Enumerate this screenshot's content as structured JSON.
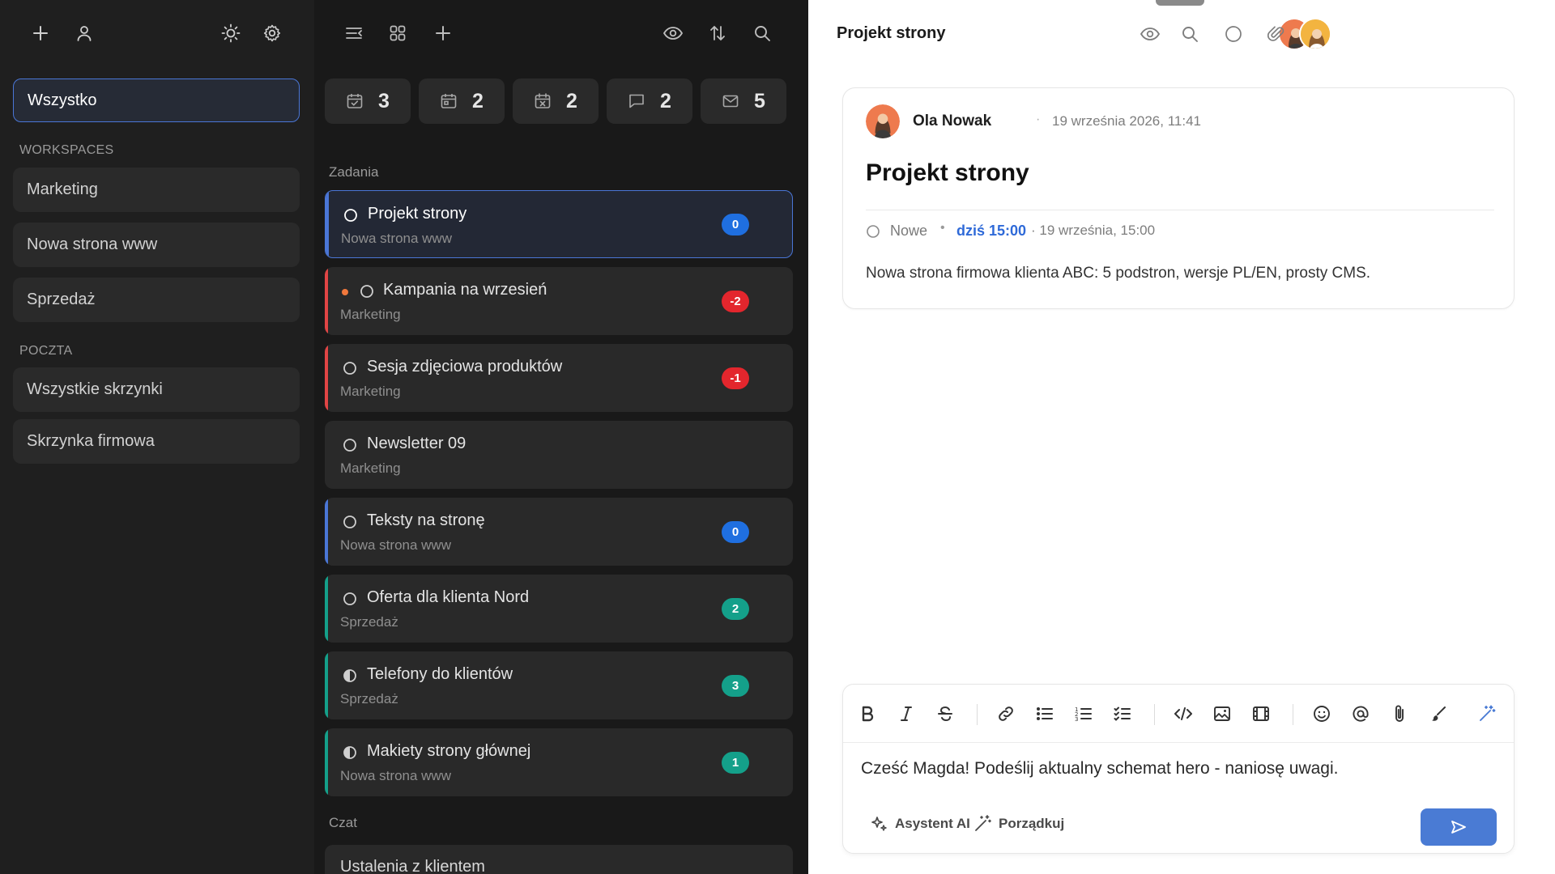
{
  "sidebar": {
    "all_label": "Wszystko",
    "workspaces_heading": "WORKSPACES",
    "workspaces": [
      "Marketing",
      "Nowa strona www",
      "Sprzedaż"
    ],
    "mail_heading": "POCZTA",
    "mailboxes": [
      "Wszystkie skrzynki",
      "Skrzynka firmowa"
    ]
  },
  "list": {
    "counters": [
      {
        "icon": "calendar-check-icon",
        "value": "3"
      },
      {
        "icon": "calendar-icon",
        "value": "2"
      },
      {
        "icon": "calendar-x-icon",
        "value": "2"
      },
      {
        "icon": "chat-icon",
        "value": "2"
      },
      {
        "icon": "mail-icon",
        "value": "5"
      }
    ],
    "tasks_heading": "Zadania",
    "tasks": [
      {
        "title": "Projekt strony",
        "workspace": "Nowa strona www",
        "badge": "0",
        "badge_color": "#1f6fe0",
        "accent": "#4a76d6",
        "status": "open",
        "selected": true
      },
      {
        "title": "Kampania na wrzesień",
        "workspace": "Marketing",
        "badge": "-2",
        "badge_color": "#e3262d",
        "accent": "#e04545",
        "status": "open",
        "priority_dot": true
      },
      {
        "title": "Sesja zdjęciowa produktów",
        "workspace": "Marketing",
        "badge": "-1",
        "badge_color": "#e3262d",
        "accent": "#e04545",
        "status": "open"
      },
      {
        "title": "Newsletter 09",
        "workspace": "Marketing",
        "badge": "",
        "badge_color": "",
        "accent": "",
        "status": "open"
      },
      {
        "title": "Teksty na stronę",
        "workspace": "Nowa strona www",
        "badge": "0",
        "badge_color": "#1f6fe0",
        "accent": "#4a76d6",
        "status": "open"
      },
      {
        "title": "Oferta dla klienta Nord",
        "workspace": "Sprzedaż",
        "badge": "2",
        "badge_color": "#14a08a",
        "accent": "#14a08a",
        "status": "open"
      },
      {
        "title": "Telefony do klientów",
        "workspace": "Sprzedaż",
        "badge": "3",
        "badge_color": "#14a08a",
        "accent": "#14a08a",
        "status": "half"
      },
      {
        "title": "Makiety strony głównej",
        "workspace": "Nowa strona www",
        "badge": "1",
        "badge_color": "#14a08a",
        "accent": "#14a08a",
        "status": "half"
      }
    ],
    "chat_heading": "Czat",
    "chats": [
      "Ustalenia z klientem"
    ]
  },
  "detail": {
    "header_title": "Projekt strony",
    "author": "Ola Nowak",
    "separator": "·",
    "created": "19 września 2026, 11:41",
    "title": "Projekt strony",
    "status": "Nowe",
    "bullet": "•",
    "due_short": "dziś 15:00",
    "due_full": "· 19 września, 15:00",
    "description": "Nowa strona firmowa klienta ABC: 5 podstron, wersje PL/EN, prosty CMS."
  },
  "editor": {
    "text": "Cześć Magda! Podeślij aktualny schemat hero - naniosę uwagi.",
    "ai_label": "Asystent AI",
    "tidy_label": "Porządkuj"
  }
}
